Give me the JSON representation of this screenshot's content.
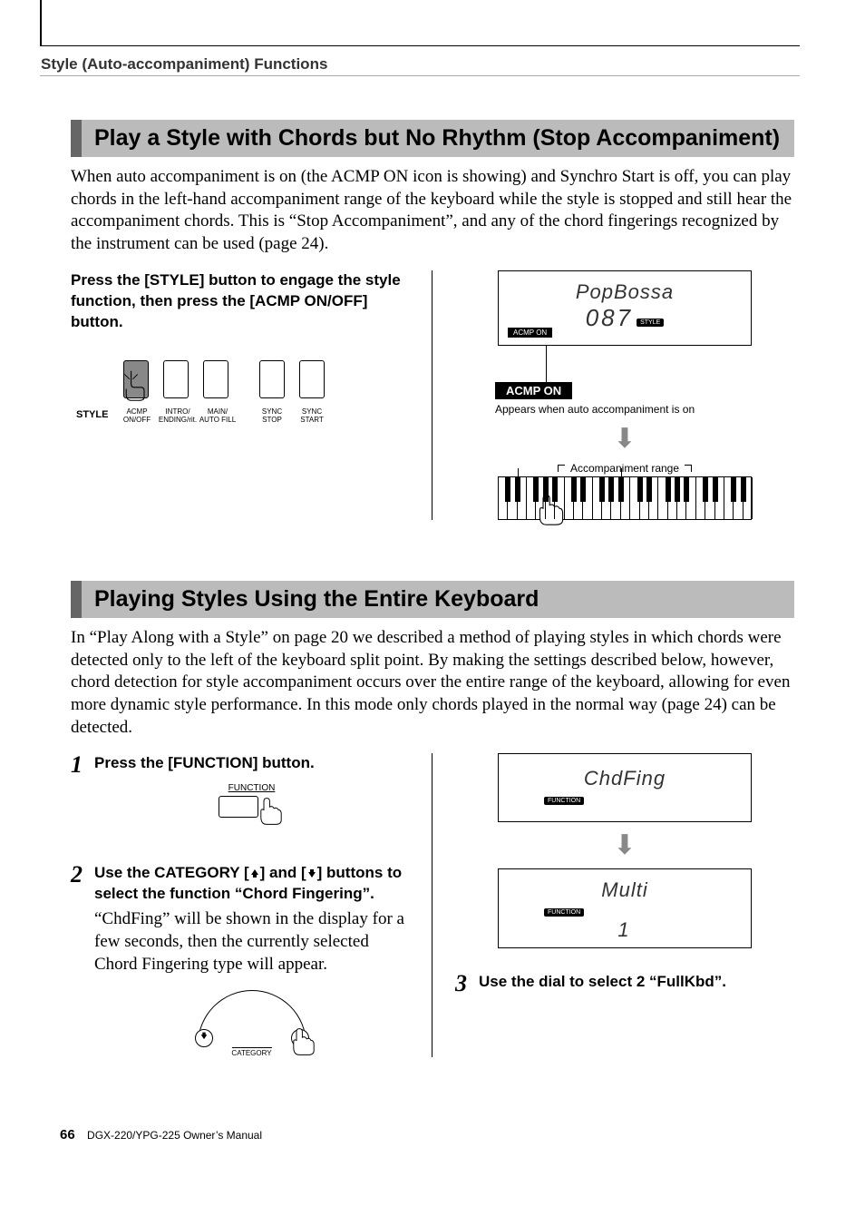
{
  "header": {
    "chapter": "Style (Auto-accompaniment) Functions"
  },
  "section1": {
    "title": "Play a Style with Chords but No Rhythm (Stop Accompaniment)",
    "paragraph": "When auto accompaniment is on (the ACMP ON icon is showing) and Synchro Start is off, you can play chords in the left-hand accompaniment range of the keyboard while the style is stopped and still hear the accompaniment chords. This is “Stop Accompaniment”, and any of the chord fingerings recognized by the instrument can be used (page 24).",
    "instruction": "Press the [STYLE] button to engage the style function, then press the [ACMP ON/OFF] button.",
    "panel": {
      "style_label": "STYLE",
      "b1": "ACMP\nON/OFF",
      "b2": "INTRO/\nENDING/rit.",
      "b3": "MAIN/\nAUTO FILL",
      "b4": "SYNC\nSTOP",
      "b5": "SYNC\nSTART"
    },
    "lcd": {
      "name": "PopBossa",
      "number": "087",
      "tag": "STYLE",
      "acmp_on": "ACMP ON"
    },
    "acmp_badge": "ACMP ON",
    "acmp_caption": "Appears when auto accompaniment is on",
    "kbd_label": "Accompaniment range"
  },
  "section2": {
    "title": "Playing Styles Using the Entire Keyboard",
    "paragraph": "In “Play Along with a Style” on page 20 we described a method of playing styles in which chords were detected only to the left of the keyboard split point. By making the settings described below, however, chord detection for style accompaniment occurs over the entire range of the keyboard, allowing for even more dynamic style performance. In this mode only chords played in the normal way (page 24) can be detected.",
    "steps": {
      "s1": {
        "num": "1",
        "text": "Press the [FUNCTION] button.",
        "btn_label": "FUNCTION"
      },
      "s2": {
        "num": "2",
        "text_a": "Use the CATEGORY [",
        "text_b": "] and [",
        "text_c": "] buttons to select the function “Chord Fingering”.",
        "sub": "“ChdFing” will be shown in the display for a few seconds, then the currently selected Chord Fingering type will appear.",
        "cat_label": "CATEGORY"
      },
      "s3": {
        "num": "3",
        "text": "Use the dial to select 2 “FullKbd”."
      }
    },
    "lcd1": {
      "name": "ChdFing",
      "tag": "FUNCTION"
    },
    "lcd2": {
      "name": "Multi",
      "number": "1",
      "tag": "FUNCTION"
    }
  },
  "footer": {
    "page": "66",
    "manual": "DGX-220/YPG-225  Owner’s Manual"
  }
}
